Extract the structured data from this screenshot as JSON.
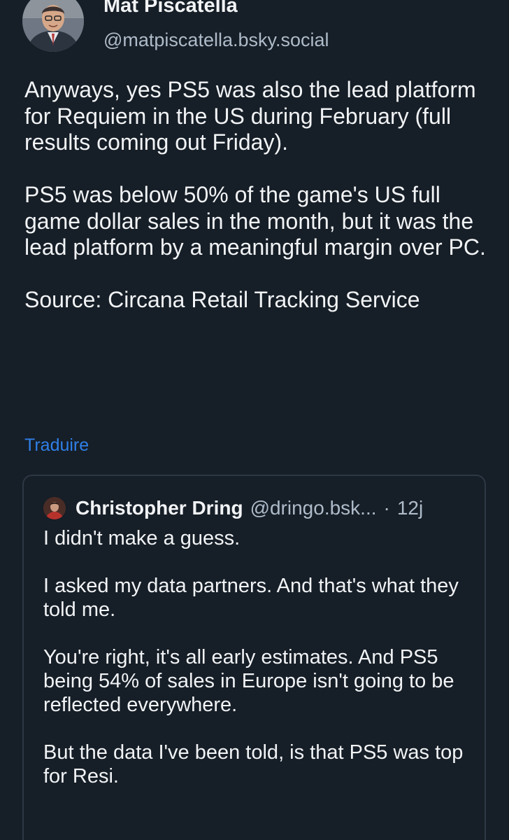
{
  "author": {
    "name": "Mat Piscatella",
    "handle": "@matpiscatella.bsky.social",
    "avatar_icon": "person-photo-avatar"
  },
  "post": {
    "paragraphs": [
      "Anyways, yes PS5 was also the lead platform for Requiem in the US during February (full results coming out Friday).",
      "PS5 was below 50% of the game's US full game dollar sales in the month, but it was the lead platform by a meaningful margin over PC.",
      "Source: Circana Retail Tracking Service"
    ],
    "translate_label": "Traduire"
  },
  "quote": {
    "author_name": "Christopher Dring",
    "author_handle": "@dringo.bsk...",
    "separator": "·",
    "time": "12j",
    "avatar_icon": "person-photo-avatar",
    "paragraphs": [
      "I didn't make a guess.",
      "I asked my data partners. And that's what they told me.",
      "You're right, it's all early estimates. And PS5 being 54% of sales in Europe isn't going to be reflected everywhere.",
      "But the data I've been told, is that PS5 was top for Resi."
    ]
  },
  "colors": {
    "background": "#161e27",
    "text": "#f1f3f5",
    "muted": "#aebbc9",
    "link": "#2f7fe8",
    "card_border": "#2d3845"
  }
}
